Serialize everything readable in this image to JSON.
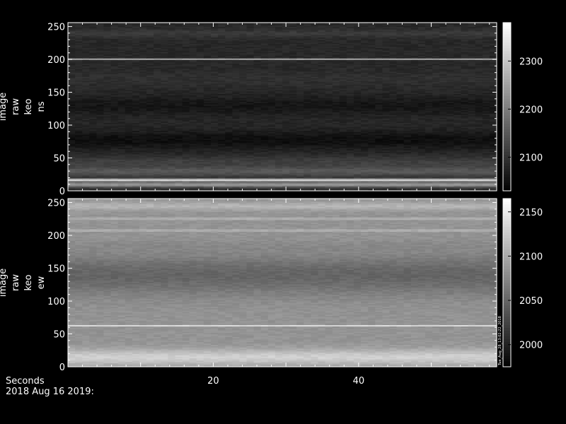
{
  "chart_data": [
    {
      "type": "heatmap",
      "ylabel": [
        "image",
        "raw",
        "keo",
        "ns"
      ],
      "ylim": [
        0,
        256
      ],
      "yticks": [
        0,
        50,
        100,
        150,
        200,
        250
      ],
      "xlim": [
        0,
        59
      ],
      "colorbar": {
        "ticks": [
          2100,
          2200,
          2300
        ],
        "range": [
          2030,
          2380
        ]
      },
      "background": 2085,
      "bands": [
        {
          "y": 10,
          "level": 2240,
          "width": 4
        },
        {
          "y": 17,
          "level": 2330,
          "width": 2
        },
        {
          "y": 30,
          "level": 2150,
          "width": 8
        },
        {
          "y": 45,
          "level": 2115,
          "width": 8
        },
        {
          "y": 78,
          "level": 2050,
          "width": 14
        },
        {
          "y": 130,
          "level": 2060,
          "width": 15
        },
        {
          "y": 170,
          "level": 2095,
          "width": 12
        },
        {
          "y": 201,
          "level": 2270,
          "width": 1
        },
        {
          "y": 240,
          "level": 2110,
          "width": 6
        }
      ]
    },
    {
      "type": "heatmap",
      "ylabel": [
        "image",
        "raw",
        "keo",
        "ew"
      ],
      "ylim": [
        0,
        256
      ],
      "yticks": [
        0,
        50,
        100,
        150,
        200,
        250
      ],
      "xlim": [
        0,
        59
      ],
      "colorbar": {
        "ticks": [
          2000,
          2050,
          2100,
          2150
        ],
        "range": [
          1975,
          2165
        ],
        "note": "Tue_Aug_28_13:02:22_2018"
      },
      "background": 2085,
      "bands": [
        {
          "y": 15,
          "level": 2130,
          "width": 12
        },
        {
          "y": 63,
          "level": 2140,
          "width": 1
        },
        {
          "y": 140,
          "level": 2050,
          "width": 30
        },
        {
          "y": 185,
          "level": 2080,
          "width": 8
        },
        {
          "y": 208,
          "level": 2135,
          "width": 1
        },
        {
          "y": 226,
          "level": 2135,
          "width": 1
        },
        {
          "y": 245,
          "level": 2110,
          "width": 6
        }
      ]
    }
  ],
  "xaxis": {
    "label": "Seconds",
    "ticks": [
      20,
      40
    ],
    "date_label": "2018 Aug 16 2019:"
  }
}
